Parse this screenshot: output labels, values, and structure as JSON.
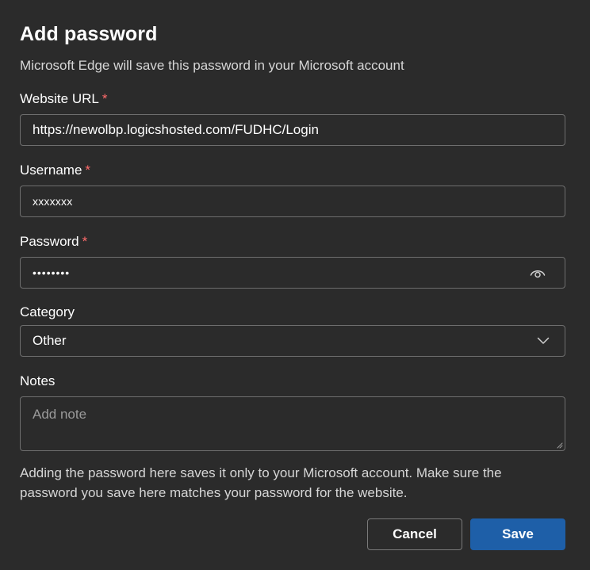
{
  "dialog": {
    "title": "Add password",
    "subtitle": "Microsoft Edge will save this password in your Microsoft account"
  },
  "fields": {
    "website_url": {
      "label": "Website URL",
      "required_mark": "*",
      "value": "https://newolbp.logicshosted.com/FUDHC/Login"
    },
    "username": {
      "label": "Username",
      "required_mark": "*",
      "value": "xxxxxxx"
    },
    "password": {
      "label": "Password",
      "required_mark": "*",
      "value": "••••••••",
      "reveal_icon": "eye-icon"
    },
    "category": {
      "label": "Category",
      "value": "Other",
      "dropdown_icon": "chevron-down-icon"
    },
    "notes": {
      "label": "Notes",
      "placeholder": "Add note",
      "value": ""
    }
  },
  "help_text": "Adding the password here saves it only to your Microsoft account. Make sure the password you save here matches your password for the website.",
  "buttons": {
    "cancel": "Cancel",
    "save": "Save"
  },
  "colors": {
    "background": "#2b2b2b",
    "required": "#ff6b6b",
    "primary": "#1e5fa8",
    "border": "#6e6e6e"
  }
}
